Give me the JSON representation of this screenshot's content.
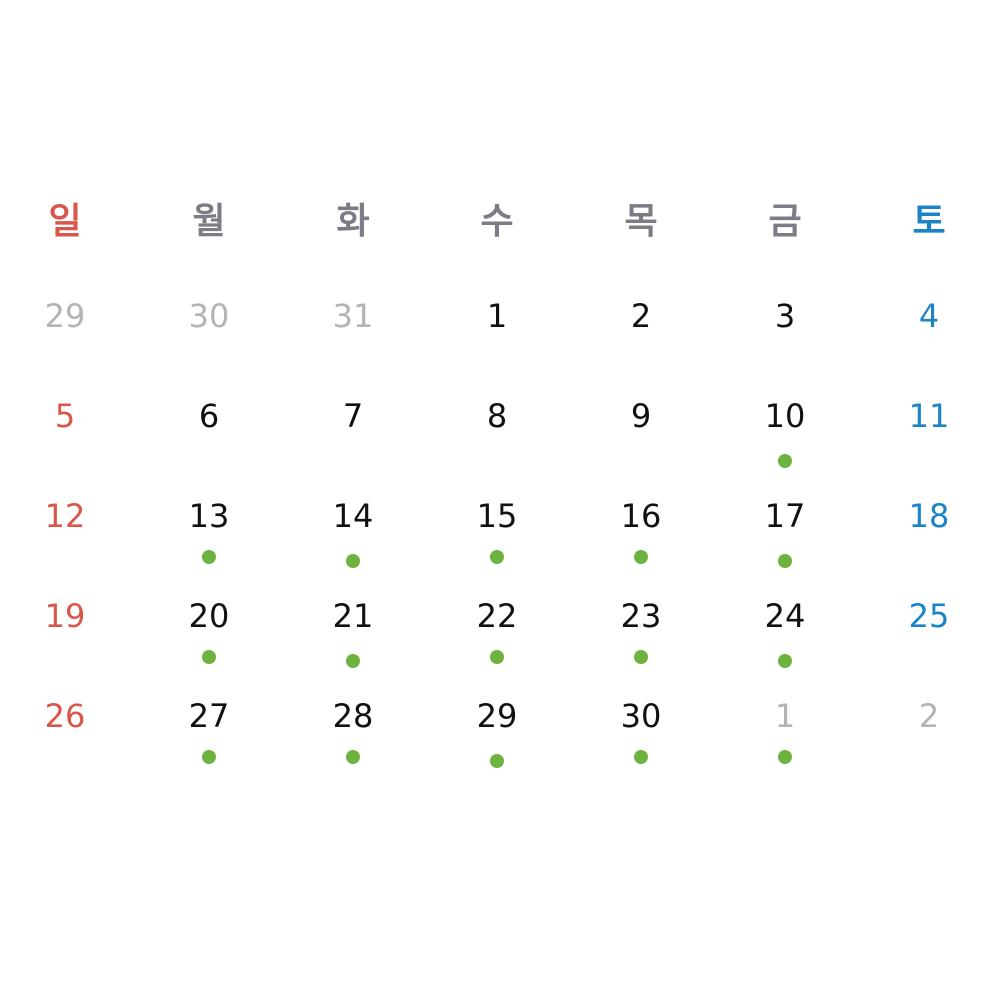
{
  "colors": {
    "sunday": "#d9574a",
    "saturday": "#1c84c6",
    "weekday_header": "#7c7c86",
    "day_text": "#111111",
    "other_month_text": "#b4b4b4",
    "event_dot": "#6db33f"
  },
  "weekdays": [
    "일",
    "월",
    "화",
    "수",
    "목",
    "금",
    "토"
  ],
  "weeks": [
    [
      {
        "day": "29",
        "other": true,
        "event": false
      },
      {
        "day": "30",
        "other": true,
        "event": false
      },
      {
        "day": "31",
        "other": true,
        "event": false
      },
      {
        "day": "1",
        "other": false,
        "event": false
      },
      {
        "day": "2",
        "other": false,
        "event": false
      },
      {
        "day": "3",
        "other": false,
        "event": false
      },
      {
        "day": "4",
        "other": false,
        "event": false
      }
    ],
    [
      {
        "day": "5",
        "other": false,
        "event": false
      },
      {
        "day": "6",
        "other": false,
        "event": false
      },
      {
        "day": "7",
        "other": false,
        "event": false
      },
      {
        "day": "8",
        "other": false,
        "event": false
      },
      {
        "day": "9",
        "other": false,
        "event": false
      },
      {
        "day": "10",
        "other": false,
        "event": true
      },
      {
        "day": "11",
        "other": false,
        "event": false
      }
    ],
    [
      {
        "day": "12",
        "other": false,
        "event": false
      },
      {
        "day": "13",
        "other": false,
        "event": true
      },
      {
        "day": "14",
        "other": false,
        "event": true
      },
      {
        "day": "15",
        "other": false,
        "event": true
      },
      {
        "day": "16",
        "other": false,
        "event": true
      },
      {
        "day": "17",
        "other": false,
        "event": true
      },
      {
        "day": "18",
        "other": false,
        "event": false
      }
    ],
    [
      {
        "day": "19",
        "other": false,
        "event": false
      },
      {
        "day": "20",
        "other": false,
        "event": true
      },
      {
        "day": "21",
        "other": false,
        "event": true
      },
      {
        "day": "22",
        "other": false,
        "event": true
      },
      {
        "day": "23",
        "other": false,
        "event": true
      },
      {
        "day": "24",
        "other": false,
        "event": true
      },
      {
        "day": "25",
        "other": false,
        "event": false
      }
    ],
    [
      {
        "day": "26",
        "other": false,
        "event": false
      },
      {
        "day": "27",
        "other": false,
        "event": true
      },
      {
        "day": "28",
        "other": false,
        "event": true
      },
      {
        "day": "29",
        "other": false,
        "event": true
      },
      {
        "day": "30",
        "other": false,
        "event": true
      },
      {
        "day": "1",
        "other": true,
        "event": true
      },
      {
        "day": "2",
        "other": true,
        "event": false
      }
    ]
  ]
}
